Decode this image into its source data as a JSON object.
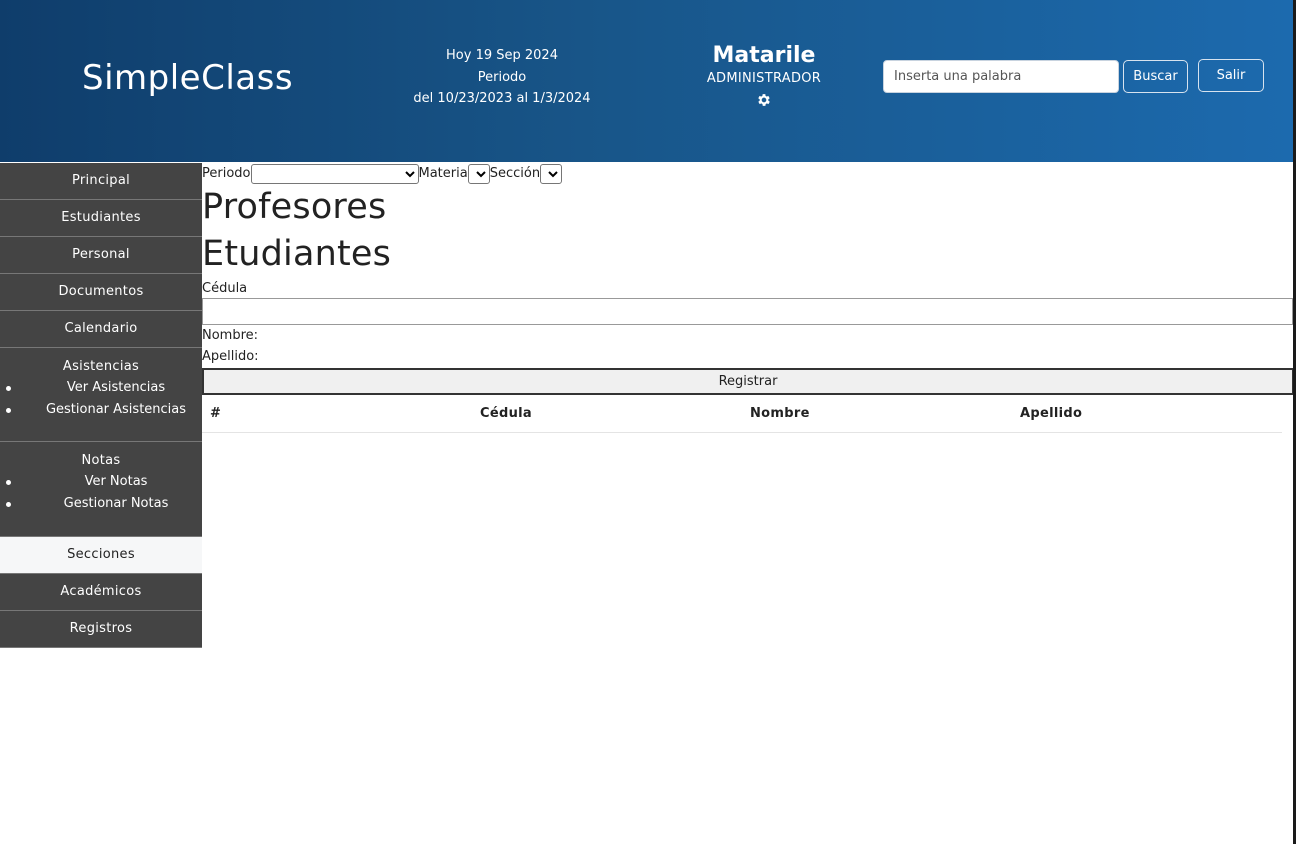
{
  "header": {
    "brand": "SimpleClass",
    "date_line": "Hoy 19 Sep 2024",
    "period_label": "Periodo",
    "period_range": "del 10/23/2023 al 1/3/2024",
    "user_name": "Matarile",
    "user_role": "ADMINISTRADOR",
    "search_placeholder": "Inserta una palabra",
    "search_button": "Buscar",
    "logout_button": "Salir"
  },
  "sidebar": {
    "principal": "Principal",
    "estudiantes": "Estudiantes",
    "personal": "Personal",
    "documentos": "Documentos",
    "calendario": "Calendario",
    "asistencias": {
      "title": "Asistencias",
      "items": [
        "Ver Asistencias",
        "Gestionar Asistencias"
      ]
    },
    "notas": {
      "title": "Notas",
      "items": [
        "Ver Notas",
        "Gestionar Notas"
      ]
    },
    "secciones": "Secciones",
    "academicos": "Académicos",
    "registros": "Registros"
  },
  "filters": {
    "periodo_label": "Periodo",
    "materia_label": "Materia",
    "seccion_label": "Sección"
  },
  "main": {
    "heading_profesores": "Profesores",
    "heading_estudiantes": "Etudiantes",
    "cedula_label": "Cédula",
    "cedula_value": "",
    "nombre_label": "Nombre:",
    "apellido_label": "Apellido:",
    "register_button": "Registrar"
  },
  "table": {
    "columns": [
      "#",
      "Cédula",
      "Nombre",
      "Apellido"
    ],
    "rows": []
  },
  "colors": {
    "header_gradient_start": "#0f3d6b",
    "header_gradient_end": "#1c6aae",
    "sidebar_bg": "#444444",
    "sidebar_active_bg": "#f6f7f8"
  }
}
